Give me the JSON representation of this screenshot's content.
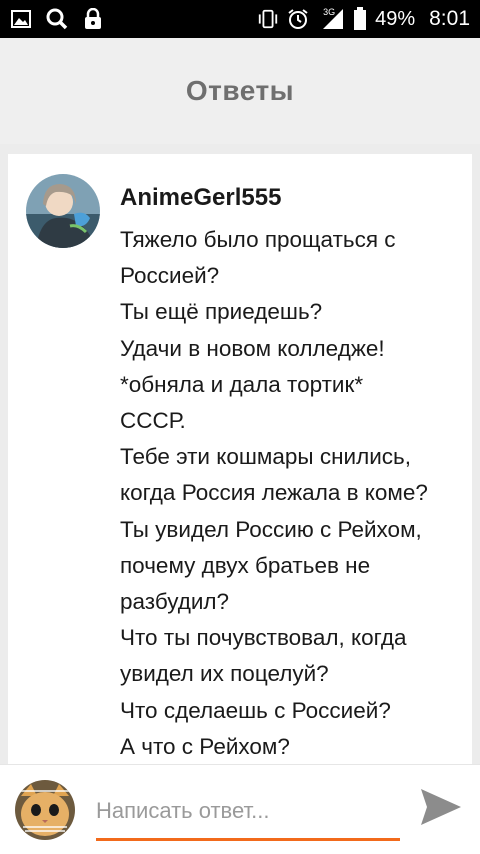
{
  "status_bar": {
    "battery": "49%",
    "time": "8:01",
    "network": "3G",
    "icons": [
      "image-icon",
      "search-icon",
      "lock-icon",
      "vibrate-icon",
      "alarm-icon",
      "signal-icon",
      "battery-icon"
    ]
  },
  "header": {
    "title": "Ответы"
  },
  "comment": {
    "username": "AnimeGerl555",
    "lines": [
      "Тяжело было прощаться с",
      "Россией?",
      "Ты ещё приедешь?",
      "Удачи в новом колледже!",
      "*обняла и дала тортик*",
      "СССР.",
      "Тебе эти кошмары снились,",
      "когда Россия лежала в коме?",
      "Ты увидел Россию с Рейхом,",
      "почему двух братьев не",
      "разбудил?",
      "Что ты почувствовал, когда",
      "увидел их поцелуй?",
      "Что сделаешь с Россией?",
      "А что с Рейхом?"
    ]
  },
  "reply": {
    "placeholder": "Написать ответ...",
    "value": ""
  },
  "colors": {
    "accent": "#f26a1b",
    "header_text": "#6f6f6f",
    "send_icon": "#8c8c8c"
  }
}
